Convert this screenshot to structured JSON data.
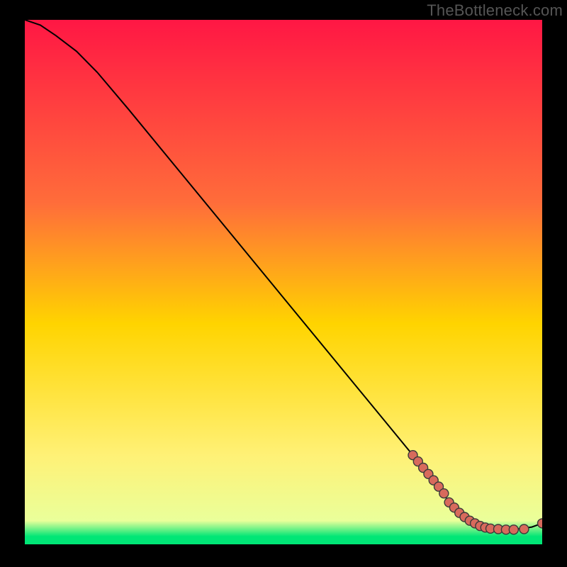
{
  "watermark": "TheBottleneck.com",
  "colors": {
    "top": "#ff1744",
    "upper": "#ff6d3a",
    "mid": "#ffd400",
    "lower": "#fff176",
    "thin": "#eaff9a",
    "bottom": "#00e676",
    "line": "#000000",
    "dot": "#d86a5c"
  },
  "chart_data": {
    "type": "line",
    "title": "",
    "xlabel": "",
    "ylabel": "",
    "xlim": [
      0,
      100
    ],
    "ylim": [
      0,
      100
    ],
    "curve": {
      "x": [
        0,
        3,
        6,
        10,
        14,
        20,
        30,
        40,
        50,
        60,
        70,
        75,
        80,
        82,
        84,
        86,
        88,
        90,
        92,
        94,
        96,
        98,
        100
      ],
      "y": [
        100,
        99,
        97,
        94,
        90,
        83,
        71,
        59,
        47,
        35,
        23,
        17,
        11,
        8,
        6,
        4.5,
        3.5,
        3,
        2.8,
        2.8,
        3,
        3.3,
        4
      ]
    },
    "dots": {
      "x": [
        75,
        76,
        77,
        78,
        79,
        80,
        81,
        82,
        83,
        84,
        85,
        86,
        87,
        88,
        89,
        90,
        91.5,
        93,
        94.5,
        96.5,
        100
      ],
      "y": [
        17,
        15.8,
        14.6,
        13.4,
        12.2,
        11,
        9.7,
        8,
        7,
        6,
        5.2,
        4.5,
        4,
        3.5,
        3.2,
        3,
        2.9,
        2.8,
        2.8,
        2.9,
        4
      ],
      "r": 3.8
    }
  }
}
